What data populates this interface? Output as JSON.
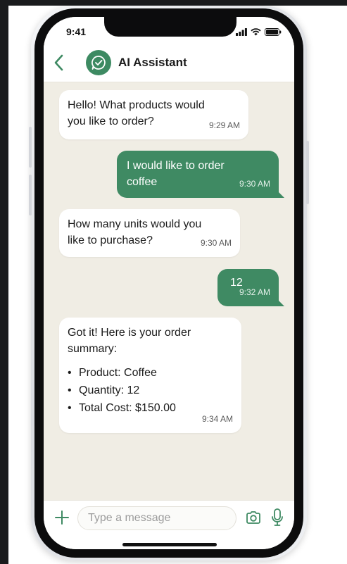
{
  "status_bar": {
    "time": "9:41"
  },
  "header": {
    "contact_name": "AI Assistant",
    "back_icon": "chevron-left-icon",
    "avatar_icon": "chat-check-icon"
  },
  "messages": [
    {
      "sender": "assistant",
      "lines": [
        "Hello! What products would",
        "you like to order?"
      ],
      "time": "9:29 AM"
    },
    {
      "sender": "user",
      "lines": [
        "I would like to order",
        "coffee"
      ],
      "time": "9:30 AM"
    },
    {
      "sender": "assistant",
      "lines": [
        "How many units would you",
        "like to purchase?"
      ],
      "time": "9:30 AM"
    },
    {
      "sender": "user",
      "lines": [
        "12"
      ],
      "time": "9:32 AM"
    },
    {
      "sender": "assistant",
      "lines": [
        "Got it! Here is your order",
        "summary:"
      ],
      "list": [
        "Product: Coffee",
        "Quantity: 12",
        "Total Cost: $150.00"
      ],
      "time": "9:34 AM"
    }
  ],
  "input_bar": {
    "placeholder": "Type a message",
    "plus_icon": "plus-icon",
    "camera_icon": "camera-icon",
    "mic_icon": "microphone-icon"
  },
  "colors": {
    "accent": "#3f8a63",
    "chat_background": "#f0ede4",
    "incoming_bubble": "#ffffff"
  }
}
